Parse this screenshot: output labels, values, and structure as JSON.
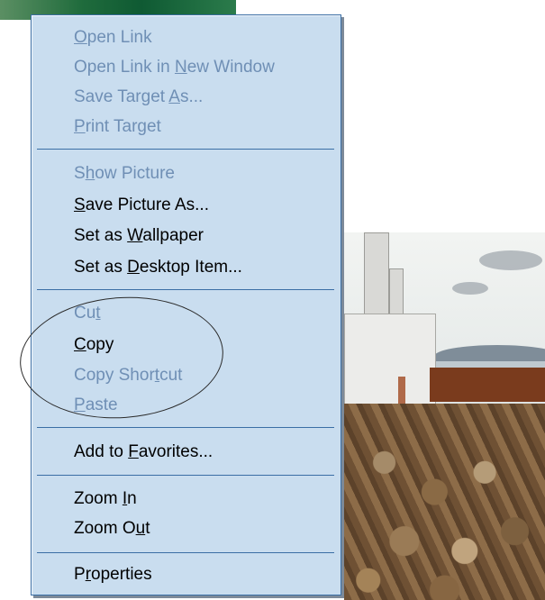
{
  "context_menu": {
    "items": [
      {
        "pre": "",
        "key": "O",
        "post": "pen Link",
        "enabled": false
      },
      {
        "pre": "Open Link in ",
        "key": "N",
        "post": "ew Window",
        "enabled": false
      },
      {
        "pre": "Save Target ",
        "key": "A",
        "post": "s...",
        "enabled": false
      },
      {
        "pre": "",
        "key": "P",
        "post": "rint Target",
        "enabled": false
      },
      {
        "pre": "S",
        "key": "h",
        "post": "ow Picture",
        "enabled": false
      },
      {
        "pre": "",
        "key": "S",
        "post": "ave Picture As...",
        "enabled": true
      },
      {
        "pre": "Set as ",
        "key": "W",
        "post": "allpaper",
        "enabled": true
      },
      {
        "pre": "Set as ",
        "key": "D",
        "post": "esktop Item...",
        "enabled": true
      },
      {
        "pre": "Cu",
        "key": "t",
        "post": "",
        "enabled": false
      },
      {
        "pre": "",
        "key": "C",
        "post": "opy",
        "enabled": true
      },
      {
        "pre": "Copy Shor",
        "key": "t",
        "post": "cut",
        "enabled": false
      },
      {
        "pre": "",
        "key": "P",
        "post": "aste",
        "enabled": false
      },
      {
        "pre": "Add to ",
        "key": "F",
        "post": "avorites...",
        "enabled": true
      },
      {
        "pre": "Zoom ",
        "key": "I",
        "post": "n",
        "enabled": true
      },
      {
        "pre": "Zoom O",
        "key": "u",
        "post": "t",
        "enabled": true
      },
      {
        "pre": "P",
        "key": "r",
        "post": "operties",
        "enabled": true
      }
    ]
  },
  "colors": {
    "menu_background": "#c9ddef",
    "menu_border": "#3a6ea5",
    "disabled_text": "#6f8fb5",
    "enabled_text": "#000000"
  }
}
